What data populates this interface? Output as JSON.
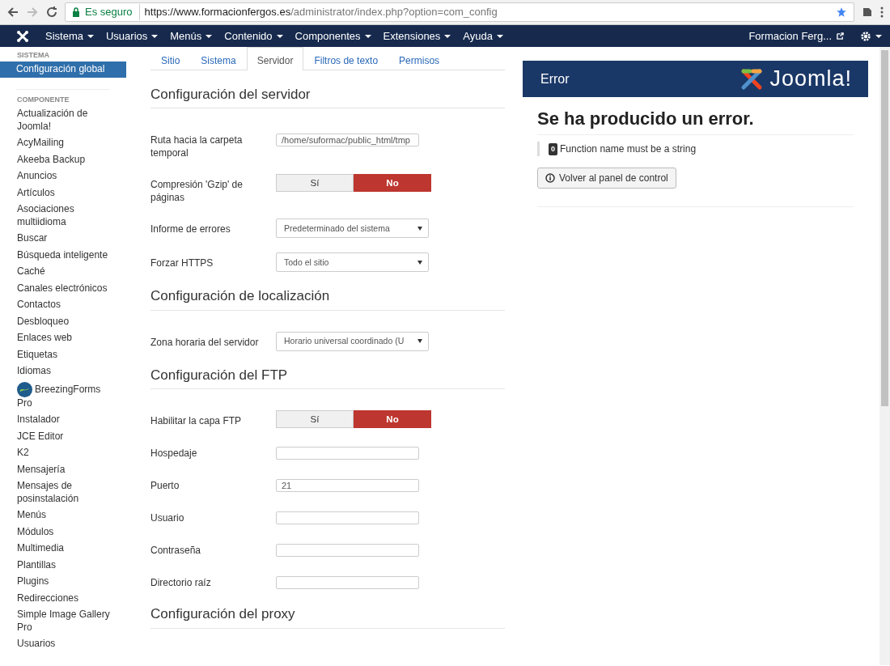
{
  "browser": {
    "secure_label": "Es seguro",
    "url_host": "https://www.formacionfergos.es",
    "url_path": "/administrator/index.php?option=com_config"
  },
  "navbar": {
    "menus": [
      "Sistema",
      "Usuarios",
      "Menús",
      "Contenido",
      "Componentes",
      "Extensiones",
      "Ayuda"
    ],
    "site_link": "Formacion Ferg..."
  },
  "sidebar": {
    "sections": [
      {
        "title": "SISTEMA",
        "items": [
          {
            "label": "Configuración global",
            "selected": true
          }
        ]
      },
      {
        "title": "COMPONENTE",
        "items": [
          {
            "label": "Actualización de Joomla!",
            "selected": false
          },
          {
            "label": "AcyMailing",
            "selected": false
          },
          {
            "label": "Akeeba Backup",
            "selected": false
          },
          {
            "label": "Anuncios",
            "selected": false
          },
          {
            "label": "Artículos",
            "selected": false
          },
          {
            "label": "Asociaciones multiidioma",
            "selected": false
          },
          {
            "label": "Buscar",
            "selected": false
          },
          {
            "label": "Búsqueda inteligente",
            "selected": false
          },
          {
            "label": "Caché",
            "selected": false
          },
          {
            "label": "Canales electrónicos",
            "selected": false
          },
          {
            "label": "Contactos",
            "selected": false
          },
          {
            "label": "Desbloqueo",
            "selected": false
          },
          {
            "label": "Enlaces web",
            "selected": false
          },
          {
            "label": "Etiquetas",
            "selected": false
          },
          {
            "label": "Idiomas",
            "selected": false
          },
          {
            "label": "BreezingForms Pro",
            "selected": false,
            "kind": "icon"
          },
          {
            "label": "Instalador",
            "selected": false
          },
          {
            "label": "JCE Editor",
            "selected": false
          },
          {
            "label": "K2",
            "selected": false
          },
          {
            "label": "Mensajería",
            "selected": false
          },
          {
            "label": "Mensajes de posinstalación",
            "selected": false
          },
          {
            "label": "Menús",
            "selected": false
          },
          {
            "label": "Módulos",
            "selected": false
          },
          {
            "label": "Multimedia",
            "selected": false
          },
          {
            "label": "Plantillas",
            "selected": false
          },
          {
            "label": "Plugins",
            "selected": false
          },
          {
            "label": "Redirecciones",
            "selected": false
          },
          {
            "label": "Simple Image Gallery Pro",
            "selected": false
          },
          {
            "label": "Usuarios",
            "selected": false
          }
        ]
      }
    ]
  },
  "tabs": [
    {
      "label": "Sitio",
      "selected": false
    },
    {
      "label": "Sistema",
      "selected": false
    },
    {
      "label": "Servidor",
      "selected": true
    },
    {
      "label": "Filtros de texto",
      "selected": false
    },
    {
      "label": "Permisos",
      "selected": false
    }
  ],
  "fieldsets": [
    {
      "title": "Configuración del servidor",
      "fields": [
        {
          "kind": "text",
          "label": "Ruta hacia la carpeta temporal",
          "value": "/home/suformac/public_html/tmp"
        },
        {
          "kind": "toggle",
          "label": "Compresión 'Gzip' de páginas",
          "options": [
            {
              "label": "Sí",
              "selected": false
            },
            {
              "label": "No",
              "selected": true
            }
          ]
        },
        {
          "kind": "select",
          "label": "Informe de errores",
          "value": "Predeterminado del sistema"
        },
        {
          "kind": "select",
          "label": "Forzar HTTPS",
          "value": "Todo el sitio"
        }
      ]
    },
    {
      "title": "Configuración de localización",
      "fields": [
        {
          "kind": "select",
          "label": "Zona horaria del servidor",
          "value": "Horario universal coordinado (U"
        }
      ]
    },
    {
      "title": "Configuración del FTP",
      "fields": [
        {
          "kind": "toggle",
          "label": "Habilitar la capa FTP",
          "options": [
            {
              "label": "Sí",
              "selected": false
            },
            {
              "label": "No",
              "selected": true
            }
          ]
        },
        {
          "kind": "text",
          "label": "Hospedaje"
        },
        {
          "kind": "text",
          "label": "Puerto",
          "value": "21"
        },
        {
          "kind": "text",
          "label": "Usuario"
        },
        {
          "kind": "text",
          "label": "Contraseña"
        },
        {
          "kind": "text",
          "label": "Directorio raíz"
        }
      ]
    },
    {
      "title": "Configuración del proxy"
    }
  ],
  "error_panel": {
    "title": "Error",
    "logo_text": "Joomla!",
    "heading": "Se ha producido un error.",
    "code": "0",
    "message": "Function name must be a string",
    "button": "Volver al panel de control"
  }
}
